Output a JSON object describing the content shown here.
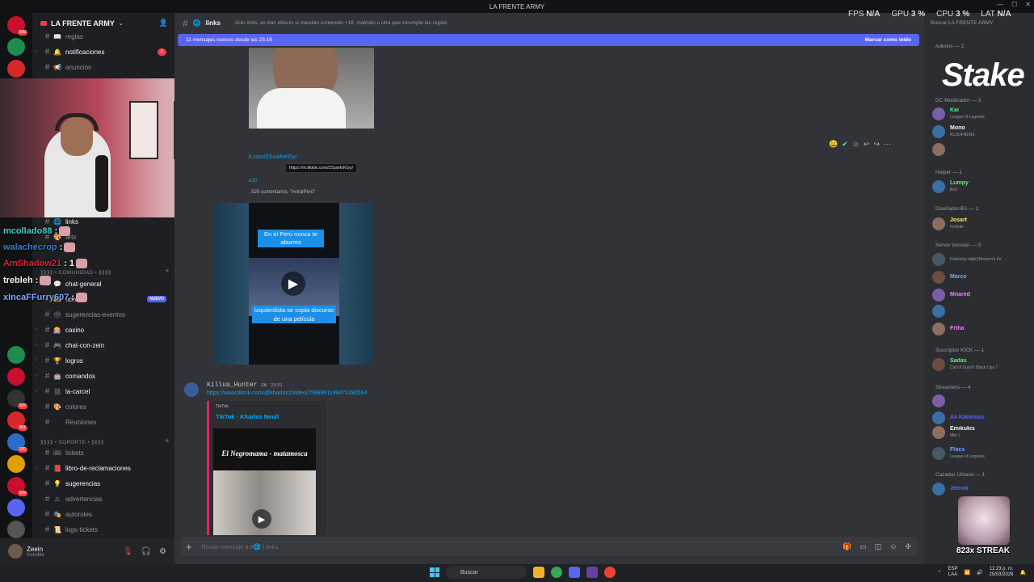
{
  "window": {
    "title": "LA FRENTE ARMY"
  },
  "rail": {
    "servers": [
      {
        "color": "#c8102e",
        "badge": "699"
      },
      {
        "color": "#1f8b4c",
        "badge": ""
      },
      {
        "color": "#d62828",
        "badge": ""
      },
      {
        "color": "#2d2d2d",
        "badge": ""
      }
    ],
    "lower_servers": [
      {
        "color": "#1f8b4c",
        "badge": ""
      },
      {
        "color": "#c8102e",
        "badge": ""
      },
      {
        "color": "#333",
        "badge": "205"
      },
      {
        "color": "#d62828",
        "badge": "361"
      },
      {
        "color": "#2a6cc9",
        "badge": "190"
      },
      {
        "color": "#e0a000",
        "badge": ""
      },
      {
        "color": "#c8102e",
        "badge": "229"
      },
      {
        "color": "#5865f2",
        "badge": ""
      },
      {
        "color": "#555",
        "badge": ""
      },
      {
        "color": "#2a6cc9",
        "badge": ""
      }
    ],
    "new_label": "NUEVO"
  },
  "server": {
    "name": "LA FRENTE ARMY",
    "channels_top": [
      {
        "name": "reglas",
        "emoji": "📖",
        "bright": false,
        "badge": ""
      },
      {
        "name": "notificaciones",
        "emoji": "🔔",
        "bright": true,
        "badge": "1"
      },
      {
        "name": "anuncios",
        "emoji": "📢",
        "bright": false,
        "badge": ""
      }
    ],
    "links_channel": "links",
    "arts_channel": "arts",
    "category_comunidad": "⟫⟫⟫⟫ • COMUNIDAD • ⟪⟪⟪⟪",
    "channels_mid": [
      {
        "name": "chat-general",
        "emoji": "💬",
        "bright": true,
        "badge": "",
        "tag": ""
      },
      {
        "name": "tickers",
        "emoji": "🎫",
        "bright": true,
        "badge": "",
        "tag": "NUEVO"
      },
      {
        "name": "sugerencias-eventos",
        "emoji": "🗳",
        "bright": false,
        "badge": "",
        "tag": ""
      },
      {
        "name": "casino",
        "emoji": "🎰",
        "bright": true,
        "badge": "",
        "tag": ""
      },
      {
        "name": "chat-con-zein",
        "emoji": "🎮",
        "bright": true,
        "badge": "",
        "tag": ""
      },
      {
        "name": "logros",
        "emoji": "🏆",
        "bright": true,
        "badge": "",
        "tag": ""
      },
      {
        "name": "comandos",
        "emoji": "🤖",
        "bright": true,
        "badge": "",
        "tag": ""
      },
      {
        "name": "la-carcel",
        "emoji": "⛓",
        "bright": true,
        "badge": "",
        "tag": ""
      },
      {
        "name": "colores",
        "emoji": "🎨",
        "bright": false,
        "badge": "",
        "tag": ""
      },
      {
        "name": "Reuniones",
        "emoji": "",
        "bright": false,
        "badge": "",
        "tag": ""
      }
    ],
    "category_soporte": "⟫⟫⟫⟫ • SOPORTE • ⟪⟪⟪⟪",
    "channels_bottom": [
      {
        "name": "tickets",
        "emoji": "🎟",
        "bright": false
      },
      {
        "name": "libro-de-reclamaciones",
        "emoji": "📕",
        "bright": true
      },
      {
        "name": "sugerencias",
        "emoji": "💡",
        "bright": true
      },
      {
        "name": "advertencias",
        "emoji": "⚠",
        "bright": false
      },
      {
        "name": "autoroles",
        "emoji": "🎭",
        "bright": false
      },
      {
        "name": "logs-tickets",
        "emoji": "📜",
        "bright": false
      }
    ]
  },
  "user": {
    "name": "Zeein",
    "status": "Invisible"
  },
  "stream_chat": [
    {
      "user": "mcollado88",
      "color": "#3fd3c7",
      "sep": ":"
    },
    {
      "user": "walachecrop",
      "color": "#3b7dd8",
      "sep": ":"
    },
    {
      "user": "AmShadow21",
      "color": "#e0213a",
      "sep": ": 1"
    },
    {
      "user": "trebleh",
      "color": "#f2f3f5",
      "sep": ":"
    },
    {
      "user": "xIncaFFurry607",
      "color": "#7aa7ff",
      "sep": ":"
    }
  ],
  "channel": {
    "name": "links",
    "topic": "Solo links, es ban directo si mandan contenido +18, maltrato u otra que incumpla las reglas",
    "new_messages": "11 mensajes nuevos desde las 23:18",
    "mark_read": "Marcar como leído",
    "tiktok_link_short": "k.com/ZSuwfxKGy/",
    "tooltip": "https://vt.tiktok.com/ZSuwfxKGy/",
    "embed_author": "u10",
    "embed_stats": ", 525 comentarios. \"#viralPerú\"",
    "video_caption_top": "En el Perú nunca te aburres",
    "video_caption_bottom": "Izquierdista se copia discurso de una película",
    "msg2_user": "Killua_Hunter",
    "msg2_tag": "FA",
    "msg2_time": "23:20",
    "msg2_link": "https://www.tiktok.com/@kharlozz/video/7588961199476280594",
    "embed2_provider": "TikTok",
    "embed2_title": "TikTok · Kharloz Neull",
    "thumb_text": "El Negromama - matamosca",
    "composer_placeholder": "Enviar mensaje a #🌐 | links"
  },
  "perf": {
    "fps_label": "FPS",
    "fps": "N/A",
    "gpu_label": "GPU",
    "gpu": "3 %",
    "cpu_label": "CPU",
    "cpu": "3 %",
    "lat_label": "LAT",
    "lat": "N/A"
  },
  "members": {
    "search": "Buscar LA FRENTE ARMY",
    "sponsor": "Stake",
    "groups": [
      {
        "header": "Admins — 2",
        "items": []
      },
      {
        "header": "DC Moderador — 3",
        "items": [
          {
            "name": "Kai",
            "act": "League of Legends",
            "color": "#57f287"
          },
          {
            "name": "Mono",
            "act": "KLOUFRENS",
            "color": "#f2f3f5"
          },
          {
            "name": "",
            "act": "",
            "color": "#f47fff"
          }
        ]
      },
      {
        "header": "Helper — 1",
        "items": [
          {
            "name": "Lumpy",
            "act": "Bot!",
            "color": "#57f287"
          }
        ]
      },
      {
        "header": "DiseñadorÆs — 1",
        "items": [
          {
            "name": "Josart",
            "act": "Fortnite",
            "color": "#fee75c"
          }
        ]
      },
      {
        "header": "Server booster — 5",
        "items": [
          {
            "name": "",
            "act": "Fate/stay night [Heaven's Fe",
            "color": "#f47fff"
          },
          {
            "name": "Marco",
            "act": "",
            "color": "#7aa7ff"
          },
          {
            "name": "Mnared",
            "act": "",
            "color": "#f47fff"
          },
          {
            "name": "",
            "act": "",
            "color": "#f47fff"
          },
          {
            "name": "Frtha",
            "act": "",
            "color": "#f47fff"
          }
        ]
      },
      {
        "header": "Suscriptor KICK — 1",
        "items": [
          {
            "name": "Sadas",
            "act": "Call of Duty®: Black Ops 7",
            "color": "#57f287"
          }
        ]
      },
      {
        "header": "Streamers — 4",
        "items": [
          {
            "name": "",
            "act": "",
            "color": "#5865f2"
          },
          {
            "name": "Ali Kämmars",
            "act": "",
            "color": "#5865f2"
          },
          {
            "name": "Emikukis",
            "act": "Milo |",
            "color": "#f2f3f5"
          },
          {
            "name": "Flocs",
            "act": "League of Legends",
            "color": "#7aa7ff"
          }
        ]
      },
      {
        "header": "Cazador Urbano — 1",
        "items": [
          {
            "name": "Jetriok",
            "act": "",
            "color": "#5865f2"
          }
        ]
      }
    ],
    "streak": "823x STREAK"
  },
  "taskbar": {
    "search": "Buscar",
    "lang": "ESP",
    "lang2": "LAA",
    "time": "11:23 p. m.",
    "date": "25/03/2026"
  }
}
